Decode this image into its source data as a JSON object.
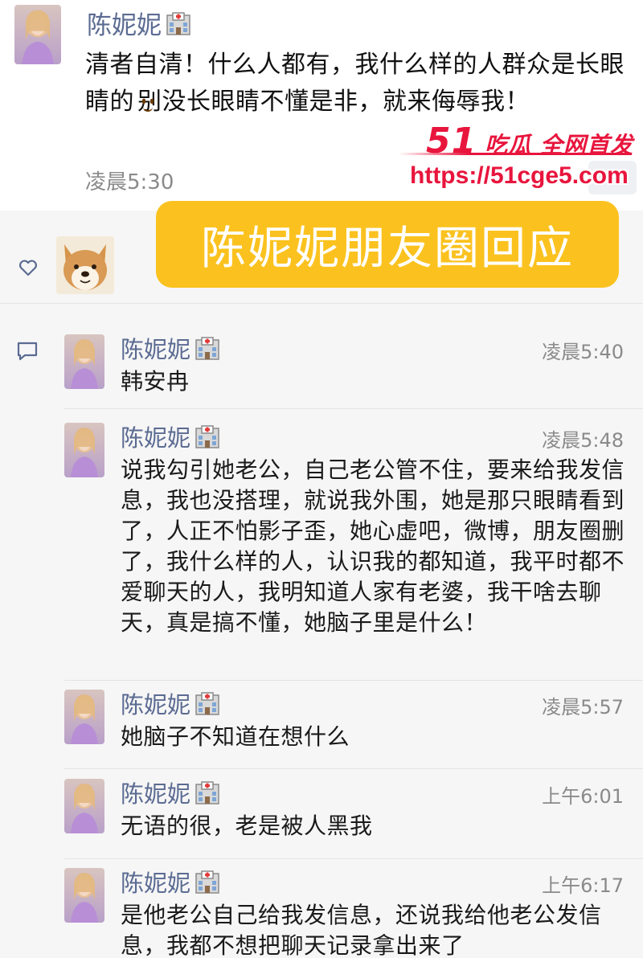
{
  "post": {
    "author": "陈妮妮",
    "text_1": "清者自清！什么人都有，我什么样的人群众是长眼睛的",
    "emoji": "smile-emoji",
    "text_2": "别没长眼睛不懂是非，就来侮辱我！",
    "time": "凌晨5:30"
  },
  "watermark": {
    "brand_num": "51",
    "brand_text": "吃瓜 全网首发",
    "url": "https://51cge5.com"
  },
  "banner": {
    "text": "陈妮妮朋友圈回应"
  },
  "comments": [
    {
      "author": "陈妮妮",
      "time": "凌晨5:40",
      "text": "韩安冉"
    },
    {
      "author": "陈妮妮",
      "time": "凌晨5:48",
      "text": "说我勾引她老公，自己老公管不住，要来给我发信息，我也没搭理，就说我外围，她是那只眼睛看到了，人正不怕影子歪，她心虚吧，微博，朋友圈删了，我什么样的人，认识我的都知道，我平时都不爱聊天的人，我明知道人家有老婆，我干啥去聊天，真是搞不懂，她脑子里是什么！"
    },
    {
      "author": "陈妮妮",
      "time": "凌晨5:57",
      "text": "她脑子不知道在想什么"
    },
    {
      "author": "陈妮妮",
      "time": "上午6:01",
      "text": "无语的很，老是被人黑我"
    },
    {
      "author": "陈妮妮",
      "time": "上午6:17",
      "text": "是他老公自己给我发信息，还说我给他老公发信息，我都不想把聊天记录拿出来了"
    }
  ],
  "colors": {
    "name": "#5b6b92",
    "watermark": "#e8153d",
    "banner": "#fbc21f"
  }
}
